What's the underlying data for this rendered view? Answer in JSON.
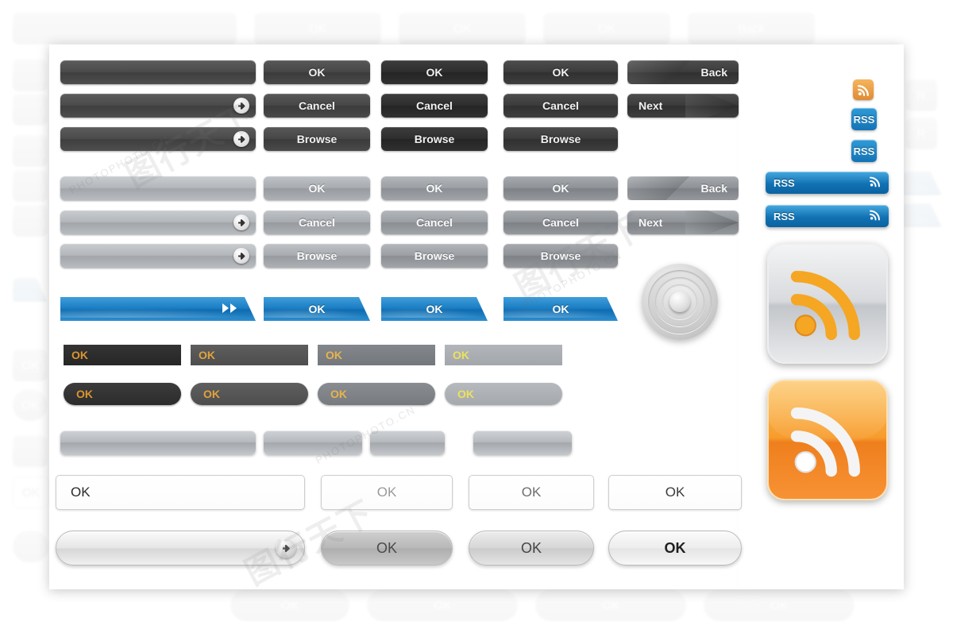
{
  "meta": {
    "watermark_text": "PHOTOPHOTO.CN",
    "watermark_glyph": "图行天下"
  },
  "palette": {
    "dark": "#3f3f3f",
    "darker": "#2e2e2e",
    "gray": "#a8acb1",
    "blue": "#1c7fc4",
    "rss_orange": "#f79c2c",
    "ok_amber": "#e0a33c",
    "silver": "#b6babe"
  },
  "rows": {
    "dark": {
      "label": "dark-button-row",
      "long": [
        {
          "text": "",
          "icon": ""
        },
        {
          "text": "",
          "icon": "arrow-right-icon"
        },
        {
          "text": "",
          "icon": "arrow-right-icon"
        }
      ],
      "col2": [
        "OK",
        "Cancel",
        "Browse"
      ],
      "col3": [
        "OK",
        "Cancel",
        "Browse"
      ],
      "col4": [
        "OK",
        "Cancel",
        "Browse"
      ],
      "col5": [
        "Back",
        "Next"
      ]
    },
    "gray": {
      "label": "gray-button-row",
      "long": [
        {
          "text": "",
          "icon": ""
        },
        {
          "text": "",
          "icon": "arrow-right-icon"
        },
        {
          "text": "",
          "icon": "arrow-right-icon"
        }
      ],
      "col2": [
        "OK",
        "Cancel",
        "Browse"
      ],
      "col3": [
        "OK",
        "Cancel",
        "Browse"
      ],
      "col4": [
        "OK",
        "Cancel",
        "Browse"
      ],
      "col5": [
        "Back",
        "Next"
      ]
    },
    "blue": {
      "label": "blue-angled-row",
      "items": [
        {
          "text": "",
          "icon": "fast-forward-icon"
        },
        {
          "text": "OK",
          "icon": ""
        },
        {
          "text": "OK",
          "icon": ""
        },
        {
          "text": "OK",
          "icon": ""
        }
      ]
    },
    "flat": {
      "label": "flat-ok-row",
      "rects": [
        {
          "text": "OK",
          "color": "#d9962f"
        },
        {
          "text": "OK",
          "color": "#e0a33c"
        },
        {
          "text": "OK",
          "color": "#e8b34c"
        },
        {
          "text": "OK",
          "color": "#ece25c"
        }
      ],
      "pills": [
        {
          "text": "OK",
          "color": "#d9962f"
        },
        {
          "text": "OK",
          "color": "#e0a33c"
        },
        {
          "text": "OK",
          "color": "#e8b34c"
        },
        {
          "text": "OK",
          "color": "#ece25c"
        }
      ]
    },
    "silver": {
      "label": "blank-silver-row",
      "widths": [
        246,
        124,
        94,
        124
      ]
    },
    "outline": {
      "label": "outlined-white-row",
      "items": [
        {
          "text": "OK",
          "align": "left",
          "color": "#2a2a2a"
        },
        {
          "text": "OK",
          "align": "center",
          "color": "#9a9a9a"
        },
        {
          "text": "OK",
          "align": "center",
          "color": "#6d6d6d"
        },
        {
          "text": "OK",
          "align": "center",
          "color": "#3a3a3a"
        }
      ]
    },
    "pills": {
      "label": "bottom-pill-row",
      "items": [
        {
          "text": "",
          "icon": "arrow-right-icon"
        },
        {
          "text": "OK",
          "icon": ""
        },
        {
          "text": "OK",
          "icon": ""
        },
        {
          "text": "OK",
          "icon": ""
        }
      ]
    }
  },
  "dial": {
    "label": "silver-dial-knob",
    "rings": 4
  },
  "sidebar": {
    "label": "rss-sidebar",
    "icon_small": {
      "name": "rss-icon",
      "style": "orange"
    },
    "badges": [
      {
        "text": "RSS"
      },
      {
        "text": "RSS"
      }
    ],
    "bars": [
      {
        "text": "RSS",
        "icon": "rss-wave-icon"
      },
      {
        "text": "RSS",
        "icon": "rss-wave-icon"
      }
    ],
    "tiles": [
      {
        "name": "rss-tile-silver",
        "style": "silver",
        "icon": "rss-wave-icon"
      },
      {
        "name": "rss-tile-orange",
        "style": "orange",
        "icon": "rss-wave-icon"
      }
    ]
  },
  "background": {
    "label": "faded-duplicate-background",
    "top_row": [
      "",
      "OK",
      "OK",
      "OK",
      "Back"
    ],
    "bottom_row": [
      "OK",
      "OK",
      "OK",
      "OK"
    ]
  }
}
